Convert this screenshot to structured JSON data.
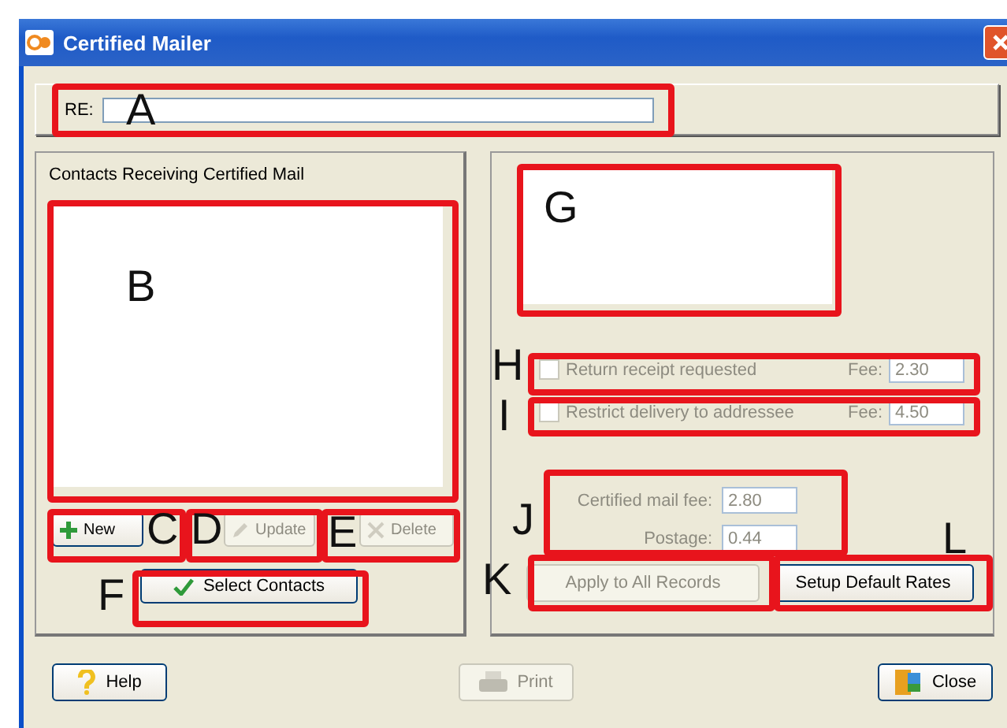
{
  "window": {
    "title": "Certified Mailer"
  },
  "re_field": {
    "label": "RE:"
  },
  "contacts": {
    "title": "Contacts Receiving Certified Mail"
  },
  "contact_buttons": [
    {
      "label": "New",
      "kind": "new",
      "disabled": false
    },
    {
      "label": "Update",
      "kind": "update",
      "disabled": true
    },
    {
      "label": "Delete",
      "kind": "delete",
      "disabled": true
    }
  ],
  "select_button": {
    "label": "Select Contacts"
  },
  "options": [
    {
      "label": "Return receipt requested",
      "checked": false,
      "disabled": true,
      "fee_label": "Fee:",
      "fee": "2.30"
    },
    {
      "label": "Restrict delivery to addressee",
      "checked": false,
      "disabled": true,
      "fee_label": "Fee:",
      "fee": "4.50"
    }
  ],
  "rates": [
    {
      "label": "Certified mail fee:",
      "value": "2.80",
      "disabled": true
    },
    {
      "label": "Postage:",
      "value": "0.44",
      "disabled": true
    }
  ],
  "apply_button": {
    "label": "Apply to All Records",
    "disabled": true
  },
  "defaults_button": {
    "label": "Setup Default Rates",
    "disabled": false
  },
  "footer_buttons": [
    {
      "label": "Help",
      "kind": "help",
      "disabled": false
    },
    {
      "label": "Print",
      "kind": "print",
      "disabled": true
    },
    {
      "label": "Close",
      "kind": "close",
      "disabled": false
    }
  ],
  "callouts": [
    {
      "label": "A"
    },
    {
      "label": "B"
    },
    {
      "label": "C"
    },
    {
      "label": "D"
    },
    {
      "label": "E"
    },
    {
      "label": "F"
    },
    {
      "label": "G"
    },
    {
      "label": "H"
    },
    {
      "label": "I"
    },
    {
      "label": "J"
    },
    {
      "label": "K"
    },
    {
      "label": "L"
    }
  ]
}
